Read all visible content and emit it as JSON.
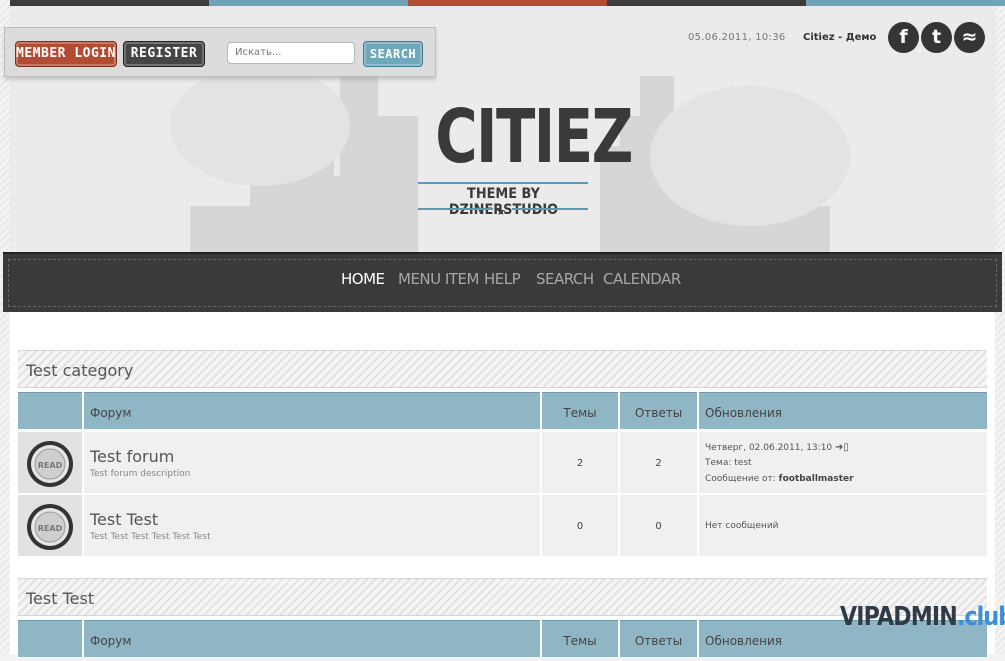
{
  "colors": {
    "strip": [
      "#3c3c3c",
      "#6fa3b9",
      "#b34c33",
      "#3c3c3c",
      "#6fa3b9"
    ],
    "accent_blue": "#8fb6c4",
    "accent_red": "#b34c33",
    "nav_bg": "#3a3a3a"
  },
  "top": {
    "member_login": "Member Login",
    "register": "Register",
    "search_placeholder": "Искать...",
    "search_button": "Search",
    "datetime": "05.06.2011, 10:36",
    "site_name": "Citiez - Демо",
    "social": [
      {
        "icon": "facebook-icon",
        "glyph": "f"
      },
      {
        "icon": "twitter-icon",
        "glyph": "t"
      },
      {
        "icon": "rss-icon",
        "glyph": "≈"
      }
    ]
  },
  "logo": {
    "title": "CITIEZ",
    "subtitle": "THEME BY DZINERSTUDIO"
  },
  "nav": {
    "items": [
      {
        "label": "Home",
        "active": true
      },
      {
        "label": "Menu Item",
        "active": false
      },
      {
        "label": "Help",
        "active": false
      },
      {
        "label": "Search",
        "active": false
      },
      {
        "label": "Calendar",
        "active": false
      }
    ]
  },
  "table_headers": {
    "forum": "Форум",
    "topics": "Темы",
    "replies": "Ответы",
    "updates": "Обновления"
  },
  "categories": [
    {
      "title": "Test category",
      "forums": [
        {
          "name": "Test forum",
          "description": "Test forum description",
          "topics": "2",
          "replies": "2",
          "last_date": "Четверг, 02.06.2011, 13:10",
          "topic_label": "Тема:",
          "topic_value": "test",
          "msg_label": "Сообщение от:",
          "msg_author": "footballmaster",
          "read_icon_text": "READ"
        },
        {
          "name": "Test Test",
          "description": "Test Test Test Test Test Test",
          "topics": "0",
          "replies": "0",
          "no_messages": "Нет сообщений",
          "read_icon_text": "READ"
        }
      ]
    },
    {
      "title": "Test Test"
    }
  ],
  "watermark": {
    "main": "VIPADMIN",
    "suffix": ".club"
  }
}
